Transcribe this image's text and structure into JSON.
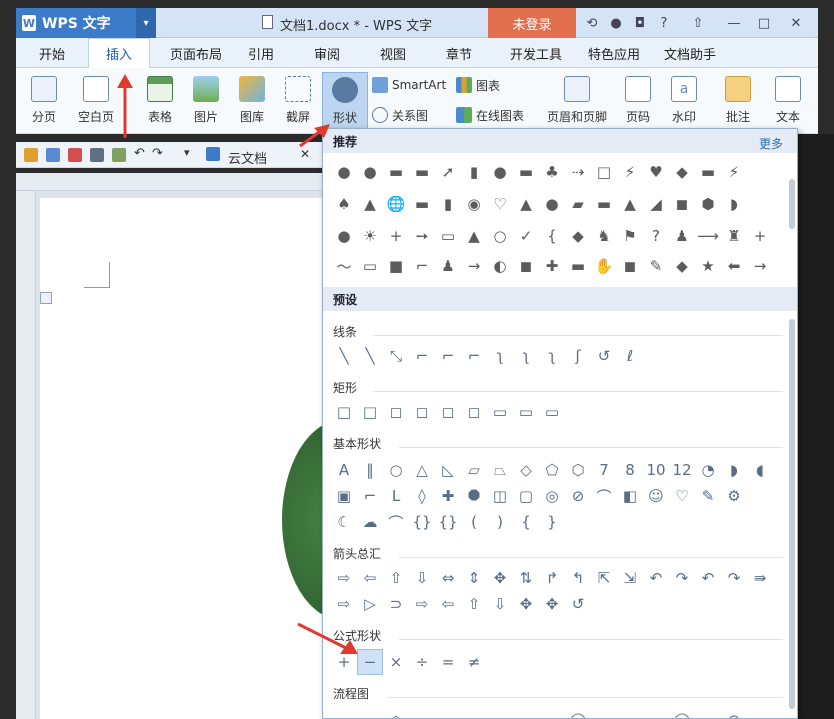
{
  "app": {
    "name": "WPS 文字",
    "login": "未登录"
  },
  "window": {
    "title": "文档1.docx * - WPS 文字"
  },
  "menu": [
    "开始",
    "插入",
    "页面布局",
    "引用",
    "审阅",
    "视图",
    "章节",
    "开发工具",
    "特色应用",
    "文档助手"
  ],
  "ribbon": {
    "page_break": "分页",
    "blank_page": "空白页",
    "table": "表格",
    "picture": "图片",
    "gallery": "图库",
    "screenshot": "截屏",
    "shapes": "形状",
    "smartart": "SmartArt",
    "chart": "图表",
    "relation": "关系图",
    "online_chart": "在线图表",
    "header_footer": "页眉和页脚",
    "page_number": "页码",
    "watermark": "水印",
    "comment": "批注",
    "textbox": "文本"
  },
  "quickbar": {
    "cloud": "云文档"
  },
  "panel": {
    "recommended": "推荐",
    "more": "更多",
    "preset": "预设",
    "sections": {
      "lines": "线条",
      "rect": "矩形",
      "basic": "基本形状",
      "arrows": "箭头总汇",
      "formula": "公式形状",
      "flowchart": "流程图"
    },
    "rec_row1": [
      "●",
      "●",
      "▬",
      "▬",
      "➚",
      "▮",
      "●",
      "▬",
      "♣",
      "⇢",
      "□",
      "⚡",
      "♥",
      "◆",
      "▬",
      "⚡"
    ],
    "rec_row2": [
      "♠",
      "▲",
      "🌐",
      "▬",
      "▮",
      "◉",
      "♡",
      "▲",
      "●",
      "▰",
      "▬",
      "▲",
      "◢",
      "◼",
      "⬢",
      "◗"
    ],
    "rec_row3": [
      "●",
      "☀",
      "+",
      "➙",
      "▭",
      "▲",
      "○",
      "✓",
      "{",
      "◆",
      "♞",
      "⚑",
      "?",
      "♟",
      "⟶",
      "♜",
      "+"
    ],
    "rec_row4": [
      "〜",
      "▭",
      "■",
      "⌐",
      "♟",
      "→",
      "◐",
      "◼",
      "✚",
      "▬",
      "✋",
      "◼",
      "✎",
      "◆",
      "★",
      "⬅",
      "→"
    ],
    "lines_row": [
      "╲",
      "╲",
      "⤡",
      "⌐",
      "⌐",
      "⌐",
      "ʅ",
      "ʅ",
      "ʅ",
      "ʃ",
      "↺",
      "ℓ"
    ],
    "rect_row": [
      "□",
      "□",
      "◻",
      "◻",
      "◻",
      "◻",
      "▭",
      "▭",
      "▭"
    ],
    "basic_row1": [
      "A",
      "‖",
      "○",
      "△",
      "◺",
      "▱",
      "⏢",
      "◇",
      "⬠",
      "⬡",
      "7",
      "8",
      "10",
      "12",
      "◔",
      "◗",
      "◖"
    ],
    "basic_row2": [
      "▣",
      "⌐",
      "L",
      "◊",
      "✚",
      "⯃",
      "◫",
      "▢",
      "◎",
      "⊘",
      "⌒",
      "◧",
      "☺",
      "♡",
      "✎",
      "⚙"
    ],
    "basic_row3": [
      "☾",
      "☁",
      "⌒",
      "{}",
      "{}",
      "(",
      ")",
      "{",
      "}"
    ],
    "arrows_row1": [
      "⇨",
      "⇦",
      "⇧",
      "⇩",
      "⇔",
      "⇕",
      "✥",
      "⇅",
      "↱",
      "↰",
      "⇱",
      "⇲",
      "↶",
      "↷",
      "↶",
      "↷",
      "⇛"
    ],
    "arrows_row2": [
      "⇨",
      "▷",
      "⊃",
      "⇨",
      "⇦",
      "⇧",
      "⇩",
      "✥",
      "✥",
      "↺"
    ],
    "formula_row": [
      "+",
      "−",
      "×",
      "÷",
      "=",
      "≠"
    ],
    "flow_row": [
      "▭",
      "▭",
      "◇",
      "▭",
      "▭",
      "▭",
      "▭",
      "▭",
      "▭",
      "◯",
      "▭",
      "▭",
      "▭",
      "◯",
      "▭",
      "⊗"
    ]
  },
  "colors": {
    "accent": "#3c7bc8",
    "login": "#e2704f",
    "arrow": "#e03a2f"
  }
}
